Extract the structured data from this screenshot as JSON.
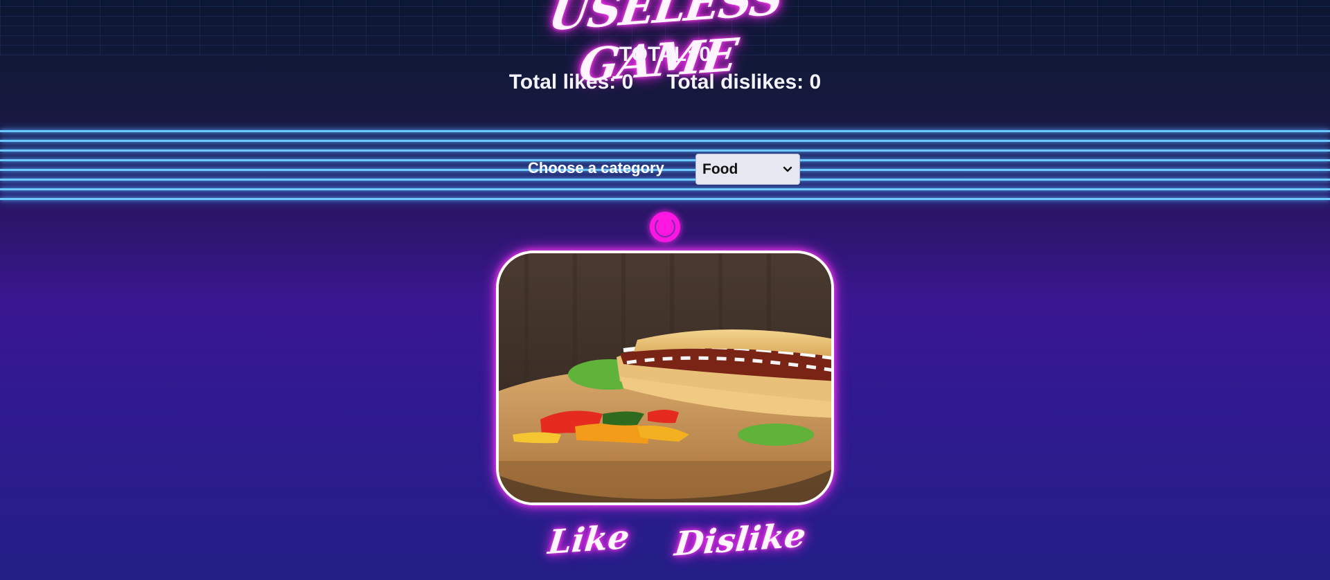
{
  "game": {
    "title": "USELESS GAME"
  },
  "stats": {
    "total_text": "TOTAL: 0",
    "likes_text": "Total likes: 0",
    "dislikes_text": "Total dislikes: 0"
  },
  "category": {
    "label": "Choose a category",
    "selected": "Food"
  },
  "actions": {
    "like": "Like",
    "dislike": "Dislike"
  },
  "colors": {
    "neon_pink": "#ff2ef0",
    "neon_blue": "#6ec9ff"
  }
}
